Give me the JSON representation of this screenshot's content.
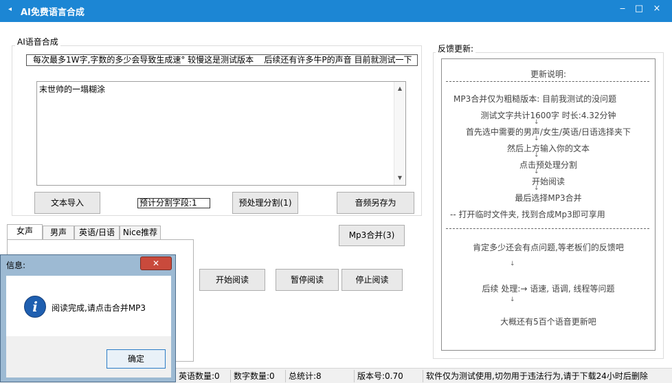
{
  "window": {
    "title": "AI免费语言合成",
    "minimize": "‒",
    "maximize": "□",
    "close": "×"
  },
  "synth": {
    "group_title": "AI语音合成",
    "notice": "每次最多1W字,字数的多少会导致生成速° 较慢这是测试版本    后续还有许多牛P的声音 目前就测试一下",
    "textarea_value": "末世帅的一塌糊涂",
    "import_button": "文本导入",
    "segments_label": "预计分割字段:1",
    "preprocess_button": "预处理分割(1)",
    "save_audio_button": "音频另存为"
  },
  "tabs": [
    "女声",
    "男声",
    "英语/日语",
    "Nice推荐"
  ],
  "active_tab": 0,
  "controls": {
    "mp3_merge_button": "Mp3合并(3)",
    "start_button": "开始阅读",
    "pause_button": "暂停阅读",
    "stop_button": "停止阅读"
  },
  "feedback": {
    "group_title": "反馈更新:",
    "heading": "更新说明:",
    "lines": [
      "MP3合并仅为粗糙版本: 目前我测试的没问题",
      "测试文字共计1600字 时长:4.32分钟",
      "首先选中需要的男声/女生/英语/日语选择夹下",
      "然后上方输入你的文本",
      "点击预处理分割",
      "开始阅读",
      "最后选择MP3合并",
      "--    打开临时文件夹, 找到合成Mp3即可享用"
    ],
    "question": "肯定多少还会有点问题,等老板们的反馈吧",
    "followup": "后续 处理:→ 语速, 语调, 线程等问题",
    "future": "大概还有5百个语音更新吧"
  },
  "status": {
    "english_count": "英语数量:0",
    "digit_count": "数字数量:0",
    "total": "总统计:8",
    "version": "版本号:0.70",
    "disclaimer": "软件仅为测试使用,切勿用于违法行为,请于下载24小时后删除"
  },
  "dialog": {
    "title": "信息:",
    "close": "✕",
    "message": "阅读完成,请点击合并MP3",
    "ok_button": "确定"
  }
}
